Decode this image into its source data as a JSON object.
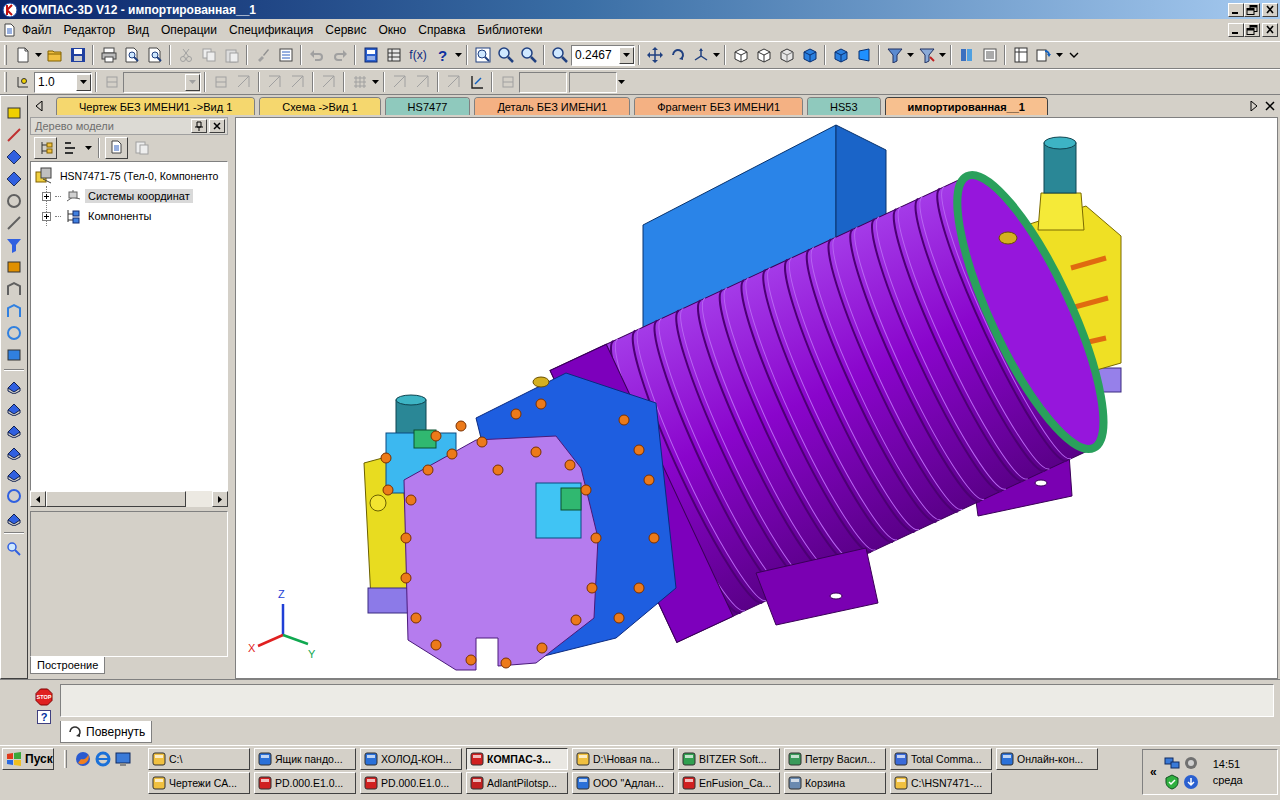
{
  "window": {
    "title": "КОМПАС-3D V12 - импортированная__1"
  },
  "menu": [
    "Файл",
    "Редактор",
    "Вид",
    "Операции",
    "Спецификация",
    "Сервис",
    "Окно",
    "Справка",
    "Библиотеки"
  ],
  "toolbar": {
    "formula": "f(x)",
    "help": "?",
    "zoom": "0.2467",
    "line_scale": "1.0"
  },
  "tabs": [
    {
      "label": "Чертеж БЕЗ ИМЕНИ1 ->Вид 1",
      "selected": false,
      "color": "#f5d76e"
    },
    {
      "label": "Схема ->Вид 1",
      "selected": false,
      "color": "#f5d76e"
    },
    {
      "label": "HS7477",
      "selected": false,
      "color": "#8fc9bd"
    },
    {
      "label": "Деталь БЕЗ ИМЕНИ1",
      "selected": false,
      "color": "#f4b183"
    },
    {
      "label": "Фрагмент БЕЗ ИМЕНИ1",
      "selected": false,
      "color": "#f4b183"
    },
    {
      "label": "HS53",
      "selected": false,
      "color": "#8fc9bd"
    },
    {
      "label": "импортированная__1",
      "selected": true,
      "color": "#f7c08f"
    }
  ],
  "tree": {
    "title": "Дерево модели",
    "items": [
      {
        "label": "HSN7471-75 (Тел-0, Компоненто",
        "kind": "root",
        "expanded": true,
        "selected": false
      },
      {
        "label": "Системы координат",
        "kind": "node",
        "expanded": false,
        "selected": true
      },
      {
        "label": "Компоненты",
        "kind": "node",
        "expanded": false,
        "selected": false
      }
    ],
    "bottom_tab": "Построение"
  },
  "viewport": {
    "axes": [
      {
        "label": "Z",
        "color": "#1f3fd6"
      },
      {
        "label": "X",
        "color": "#e02020"
      },
      {
        "label": "Y",
        "color": "#10a850"
      }
    ]
  },
  "command": {
    "stop": "STOP",
    "help": "?",
    "tab": {
      "label": "Повернуть",
      "selected": true
    }
  },
  "taskbar": {
    "start": "Пуск",
    "rows": [
      [
        {
          "label": "C:\\",
          "selected": false
        },
        {
          "label": "Ящик пандо...",
          "selected": false
        },
        {
          "label": "ХОЛОД-КОН...",
          "selected": false
        },
        {
          "label": "КОМПАС-3...",
          "selected": true
        },
        {
          "label": "D:\\Новая па...",
          "selected": false
        },
        {
          "label": "BITZER Soft...",
          "selected": false
        },
        {
          "label": "Петру Васил...",
          "selected": false
        },
        {
          "label": "Total Comma...",
          "selected": false
        },
        {
          "label": "Онлайн-кон...",
          "selected": false
        }
      ],
      [
        {
          "label": "Чертежи CA...",
          "selected": false
        },
        {
          "label": "PD.000.E1.0...",
          "selected": false
        },
        {
          "label": "PD.000.E1.0...",
          "selected": false
        },
        {
          "label": "AdlantPilotsp...",
          "selected": false
        },
        {
          "label": "ООО \"Адлан...",
          "selected": false
        },
        {
          "label": "EnFusion_Ca...",
          "selected": false
        },
        {
          "label": "Корзина",
          "selected": false
        },
        {
          "label": "C:\\HSN7471-...",
          "selected": false
        }
      ]
    ],
    "tray": {
      "expand": "«",
      "time": "14:51",
      "day": "среда"
    }
  }
}
